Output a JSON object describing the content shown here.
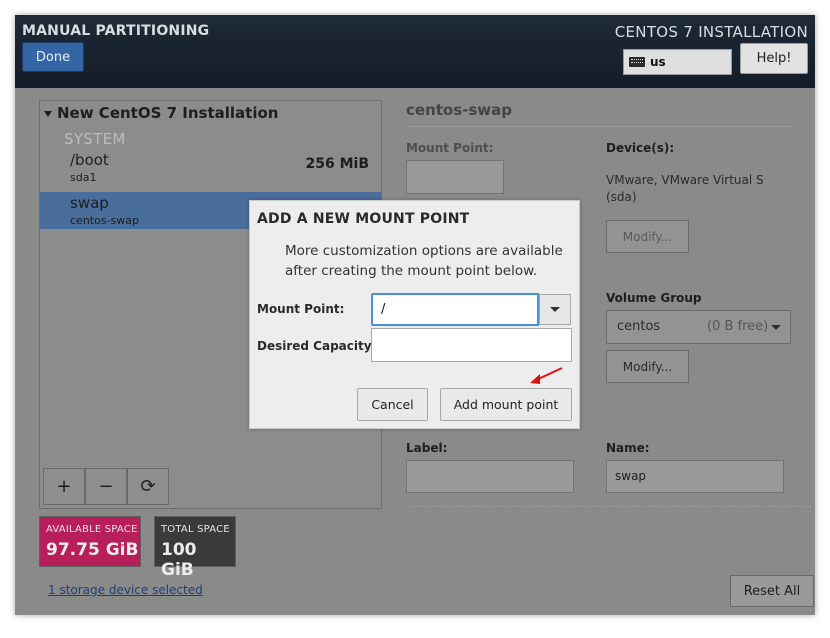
{
  "header": {
    "title": "MANUAL PARTITIONING",
    "done_label": "Done",
    "installer_title": "CENTOS 7 INSTALLATION",
    "keyboard_layout": "us",
    "help_label": "Help!"
  },
  "tree": {
    "root_label": "New CentOS 7 Installation",
    "group_label": "SYSTEM",
    "items": [
      {
        "name": "/boot",
        "device": "sda1",
        "size": "256 MiB",
        "selected": false
      },
      {
        "name": "swap",
        "device": "centos-swap",
        "size": "",
        "selected": true
      }
    ],
    "toolbar": {
      "add": "+",
      "remove": "−",
      "reload": "⟳"
    }
  },
  "space": {
    "available_label": "AVAILABLE SPACE",
    "available_value": "97.75 GiB",
    "total_label": "TOTAL SPACE",
    "total_value": "100 GiB"
  },
  "storage_link": "1 storage device selected",
  "reset_label": "Reset All",
  "details": {
    "title": "centos-swap",
    "mount_point_label": "Mount Point:",
    "devices_label": "Device(s):",
    "devices_text_line1": "VMware, VMware Virtual S",
    "devices_text_line2": "(sda)",
    "modify_label": "Modify...",
    "volume_group_label": "Volume Group",
    "volume_group_name": "centos",
    "volume_group_free": "(0 B free)",
    "vg_modify_label": "Modify...",
    "label_label": "Label:",
    "name_label": "Name:",
    "name_value": "swap"
  },
  "dialog": {
    "title": "ADD A NEW MOUNT POINT",
    "message": "More customization options are available after creating the mount point below.",
    "mount_point_label": "Mount Point:",
    "mount_point_value": "/",
    "capacity_label": "Desired Capacity:",
    "capacity_value": "",
    "cancel_label": "Cancel",
    "add_label": "Add mount point"
  },
  "colors": {
    "header_bg": "#1f2a38",
    "accent_blue": "#3465a4",
    "available_space": "#b71e5a",
    "total_space": "#3a3a3a",
    "selection": "#4a6e9b",
    "focus_border": "#4a90d9",
    "annotation_arrow": "#e01010"
  }
}
